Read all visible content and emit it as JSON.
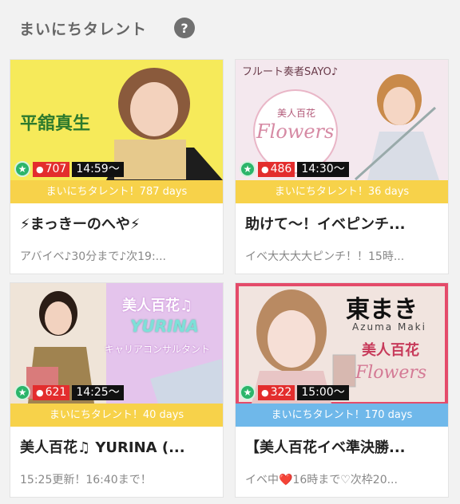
{
  "header": {
    "title": "まいにちタレント",
    "help_glyph": "?"
  },
  "cards": [
    {
      "thumb_text": "平舘真生",
      "level_glyph": "★",
      "viewers": "707",
      "time": "14:59〜",
      "days": "まいにちタレント！787 days",
      "band_color": "#f7d24a",
      "title": "⚡まっきーのへや⚡",
      "subtitle": "アバイベ♪30分まで♪次19:..."
    },
    {
      "thumb_text": "フルート奏者SAYO♪",
      "thumb_text2": "美人百花",
      "thumb_text3": "Flowers",
      "level_glyph": "★",
      "viewers": "486",
      "time": "14:30〜",
      "days": "まいにちタレント！36 days",
      "band_color": "#f7d24a",
      "title": "助けて〜！イベピンチ...",
      "subtitle": "イベ大大大大ピンチ！！15時..."
    },
    {
      "thumb_text": "美人百花♫",
      "thumb_text2": "YURINA",
      "thumb_text3": "キャリアコンサルタント",
      "level_glyph": "★",
      "viewers": "621",
      "time": "14:25〜",
      "days": "まいにちタレント！40 days",
      "band_color": "#f7d24a",
      "title": "美人百花♫ YURINA (...",
      "subtitle": "15:25更新！16:40まで！"
    },
    {
      "thumb_text": "東まき",
      "thumb_text2": "Azuma Maki",
      "thumb_text3": "美人百花",
      "thumb_text4": "Flowers",
      "level_glyph": "★",
      "viewers": "322",
      "time": "15:00〜",
      "days": "まいにちタレント！170 days",
      "band_color": "#6fb8ea",
      "title": "【美人百花イベ準決勝...",
      "subtitle": "イベ中❤️16時まで♡次枠20..."
    }
  ]
}
